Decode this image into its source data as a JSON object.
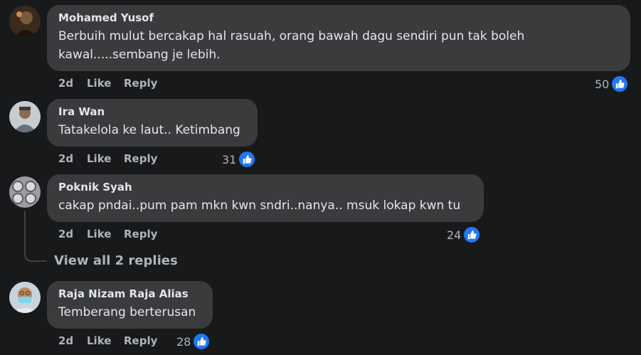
{
  "colors": {
    "background": "#18191a",
    "bubble": "#3a3b3c",
    "like_blue": "#2078f4",
    "muted_text": "#b0b3b8"
  },
  "like_label": "Like",
  "reply_label": "Reply",
  "comments": [
    {
      "author": "Mohamed Yusof",
      "text_lines": [
        "Berbuih mulut bercakap hal rasuah, orang bawah dagu sendiri pun tak boleh",
        "kawal.....sembang je lebih."
      ],
      "time": "2d",
      "likes": "50"
    },
    {
      "author": "Ira Wan",
      "text_lines": [
        "Tatakelola ke laut.. Ketimbang"
      ],
      "time": "2d",
      "likes": "31"
    },
    {
      "author": "Poknik Syah",
      "text_lines": [
        "cakap pndai..pum pam mkn kwn sndri..nanya.. msuk lokap kwn tu"
      ],
      "time": "2d",
      "likes": "24"
    },
    {
      "author": "Raja Nizam Raja Alias",
      "text_lines": [
        "Temberang berterusan"
      ],
      "time": "2d",
      "likes": "28"
    }
  ],
  "view_replies_label": "View all 2 replies"
}
